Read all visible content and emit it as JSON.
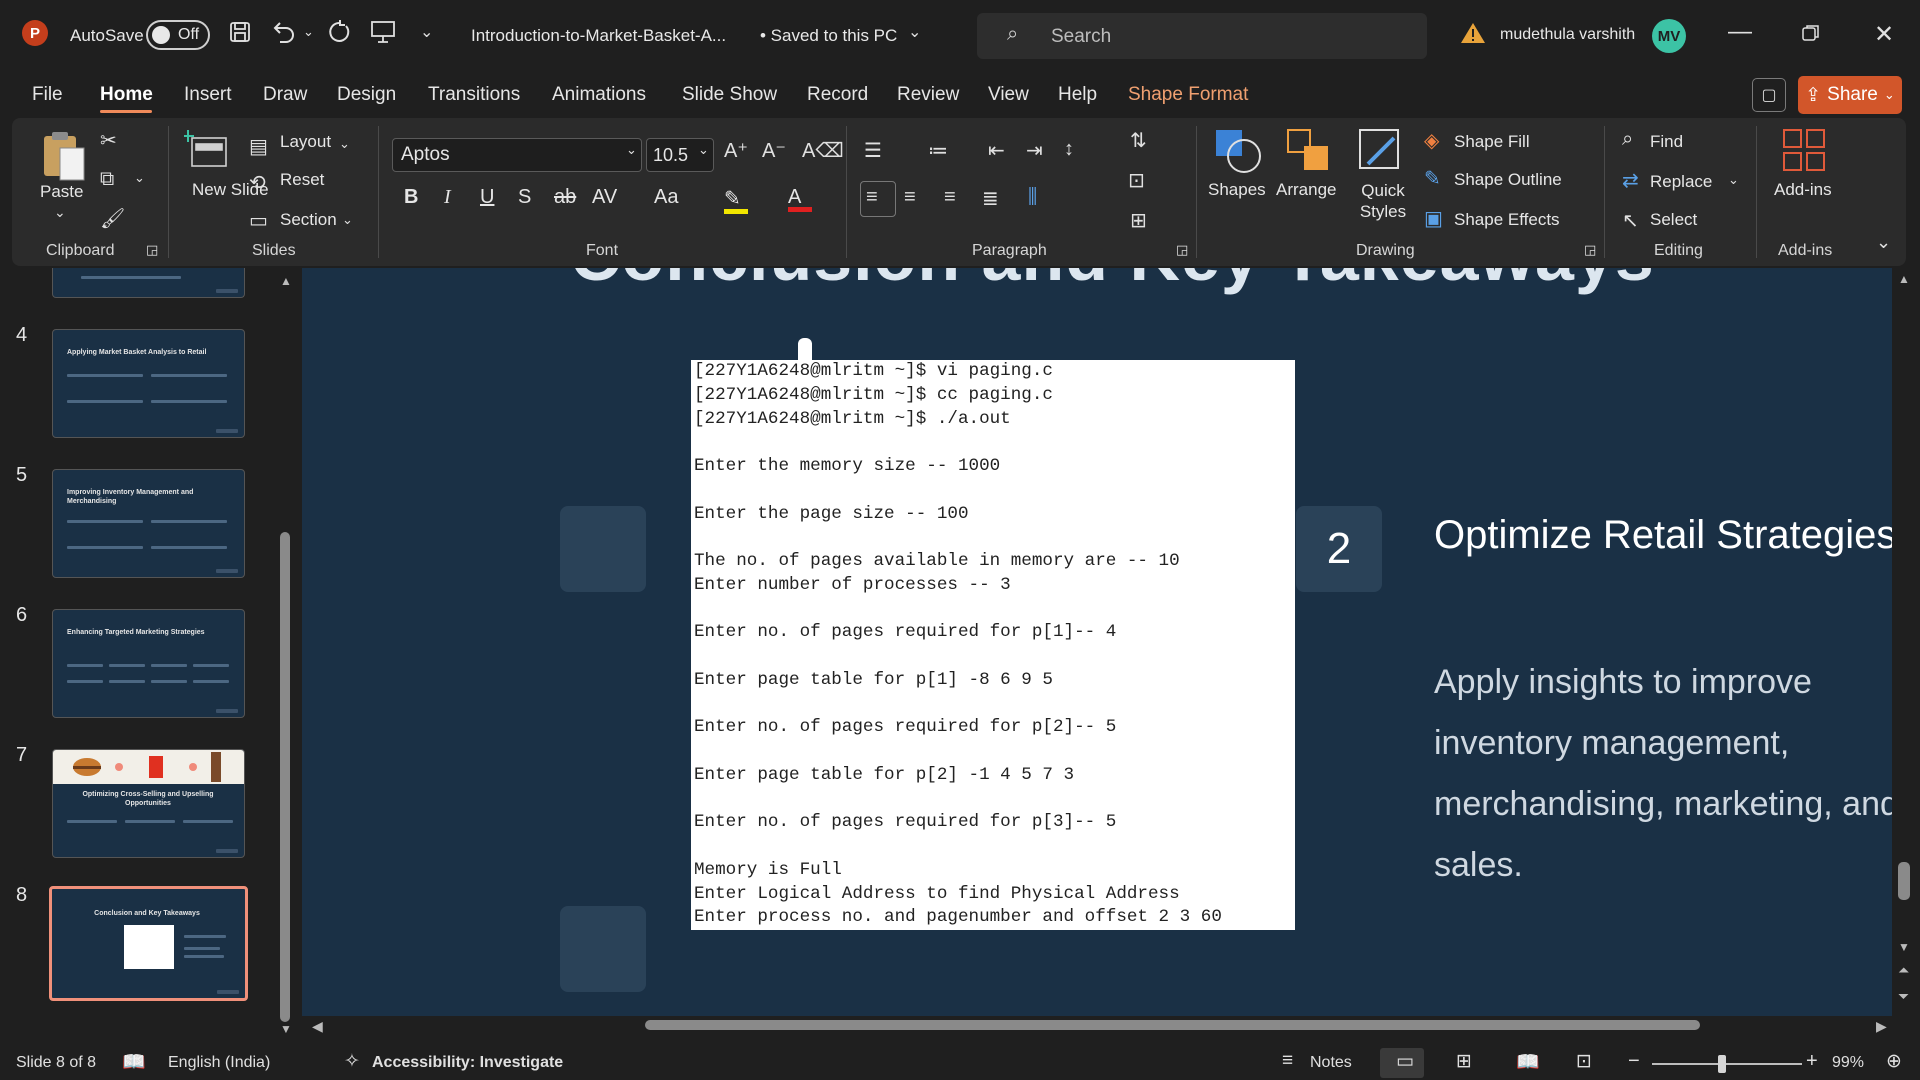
{
  "app": {
    "autosave_label": "AutoSave",
    "autosave_state": "Off",
    "doc_title": "Introduction-to-Market-Basket-A...",
    "save_status": "• Saved to this PC",
    "search_placeholder": "Search",
    "user_name": "mudethula varshith",
    "user_initials": "MV"
  },
  "menu": {
    "tabs": [
      "File",
      "Home",
      "Insert",
      "Draw",
      "Design",
      "Transitions",
      "Animations",
      "Slide Show",
      "Record",
      "Review",
      "View",
      "Help",
      "Shape Format"
    ],
    "share_label": "Share"
  },
  "ribbon": {
    "clipboard": {
      "paste": "Paste",
      "group": "Clipboard"
    },
    "slides": {
      "new_slide": "New Slide",
      "layout": "Layout",
      "reset": "Reset",
      "section": "Section",
      "group": "Slides"
    },
    "font": {
      "family": "Aptos",
      "size": "10.5",
      "group": "Font"
    },
    "paragraph": {
      "group": "Paragraph"
    },
    "drawing": {
      "shapes": "Shapes",
      "arrange": "Arrange",
      "quick_styles": "Quick Styles",
      "shape_fill": "Shape Fill",
      "shape_outline": "Shape Outline",
      "shape_effects": "Shape Effects",
      "group": "Drawing"
    },
    "editing": {
      "find": "Find",
      "replace": "Replace",
      "select": "Select",
      "group": "Editing"
    },
    "addins": {
      "label": "Add-ins",
      "group": "Add-ins"
    }
  },
  "thumbnails": [
    {
      "num": "4",
      "title": "Applying Market Basket Analysis to Retail"
    },
    {
      "num": "5",
      "title": "Improving Inventory Management and Merchandising"
    },
    {
      "num": "6",
      "title": "Enhancing Targeted Marketing Strategies"
    },
    {
      "num": "7",
      "title": "Optimizing Cross-Selling and Upselling Opportunities"
    },
    {
      "num": "8",
      "title": "Conclusion and Key Takeaways"
    }
  ],
  "slide": {
    "title": "Conclusion and Key Takeaways",
    "card_number": "2",
    "card_title": "Optimize Retail Strategies",
    "card_body": "Apply insights to improve inventory management, merchandising, marketing, and sales.",
    "terminal_lines": [
      "[227Y1A6248@mlritm ~]$ vi paging.c",
      "[227Y1A6248@mlritm ~]$ cc paging.c",
      "[227Y1A6248@mlritm ~]$ ./a.out",
      "",
      "Enter the memory size -- 1000",
      "",
      "Enter the page size -- 100",
      "",
      "The no. of pages available in memory are -- 10",
      "Enter number of processes -- 3",
      "",
      "Enter no. of pages required for p[1]-- 4",
      "",
      "Enter page table for p[1] -8 6 9 5",
      "",
      "Enter no. of pages required for p[2]-- 5",
      "",
      "Enter page table for p[2] -1 4 5 7 3",
      "",
      "Enter no. of pages required for p[3]-- 5",
      "",
      "Memory is Full",
      "Enter Logical Address to find Physical Address",
      "Enter process no. and pagenumber and offset 2 3 60"
    ]
  },
  "status": {
    "slide_counter": "Slide 8 of 8",
    "language": "English (India)",
    "accessibility": "Accessibility: Investigate",
    "notes": "Notes",
    "zoom": "99%"
  },
  "colors": {
    "accent": "#d2562a",
    "slide_bg": "#1a3045",
    "card_bg": "#2a4258"
  }
}
